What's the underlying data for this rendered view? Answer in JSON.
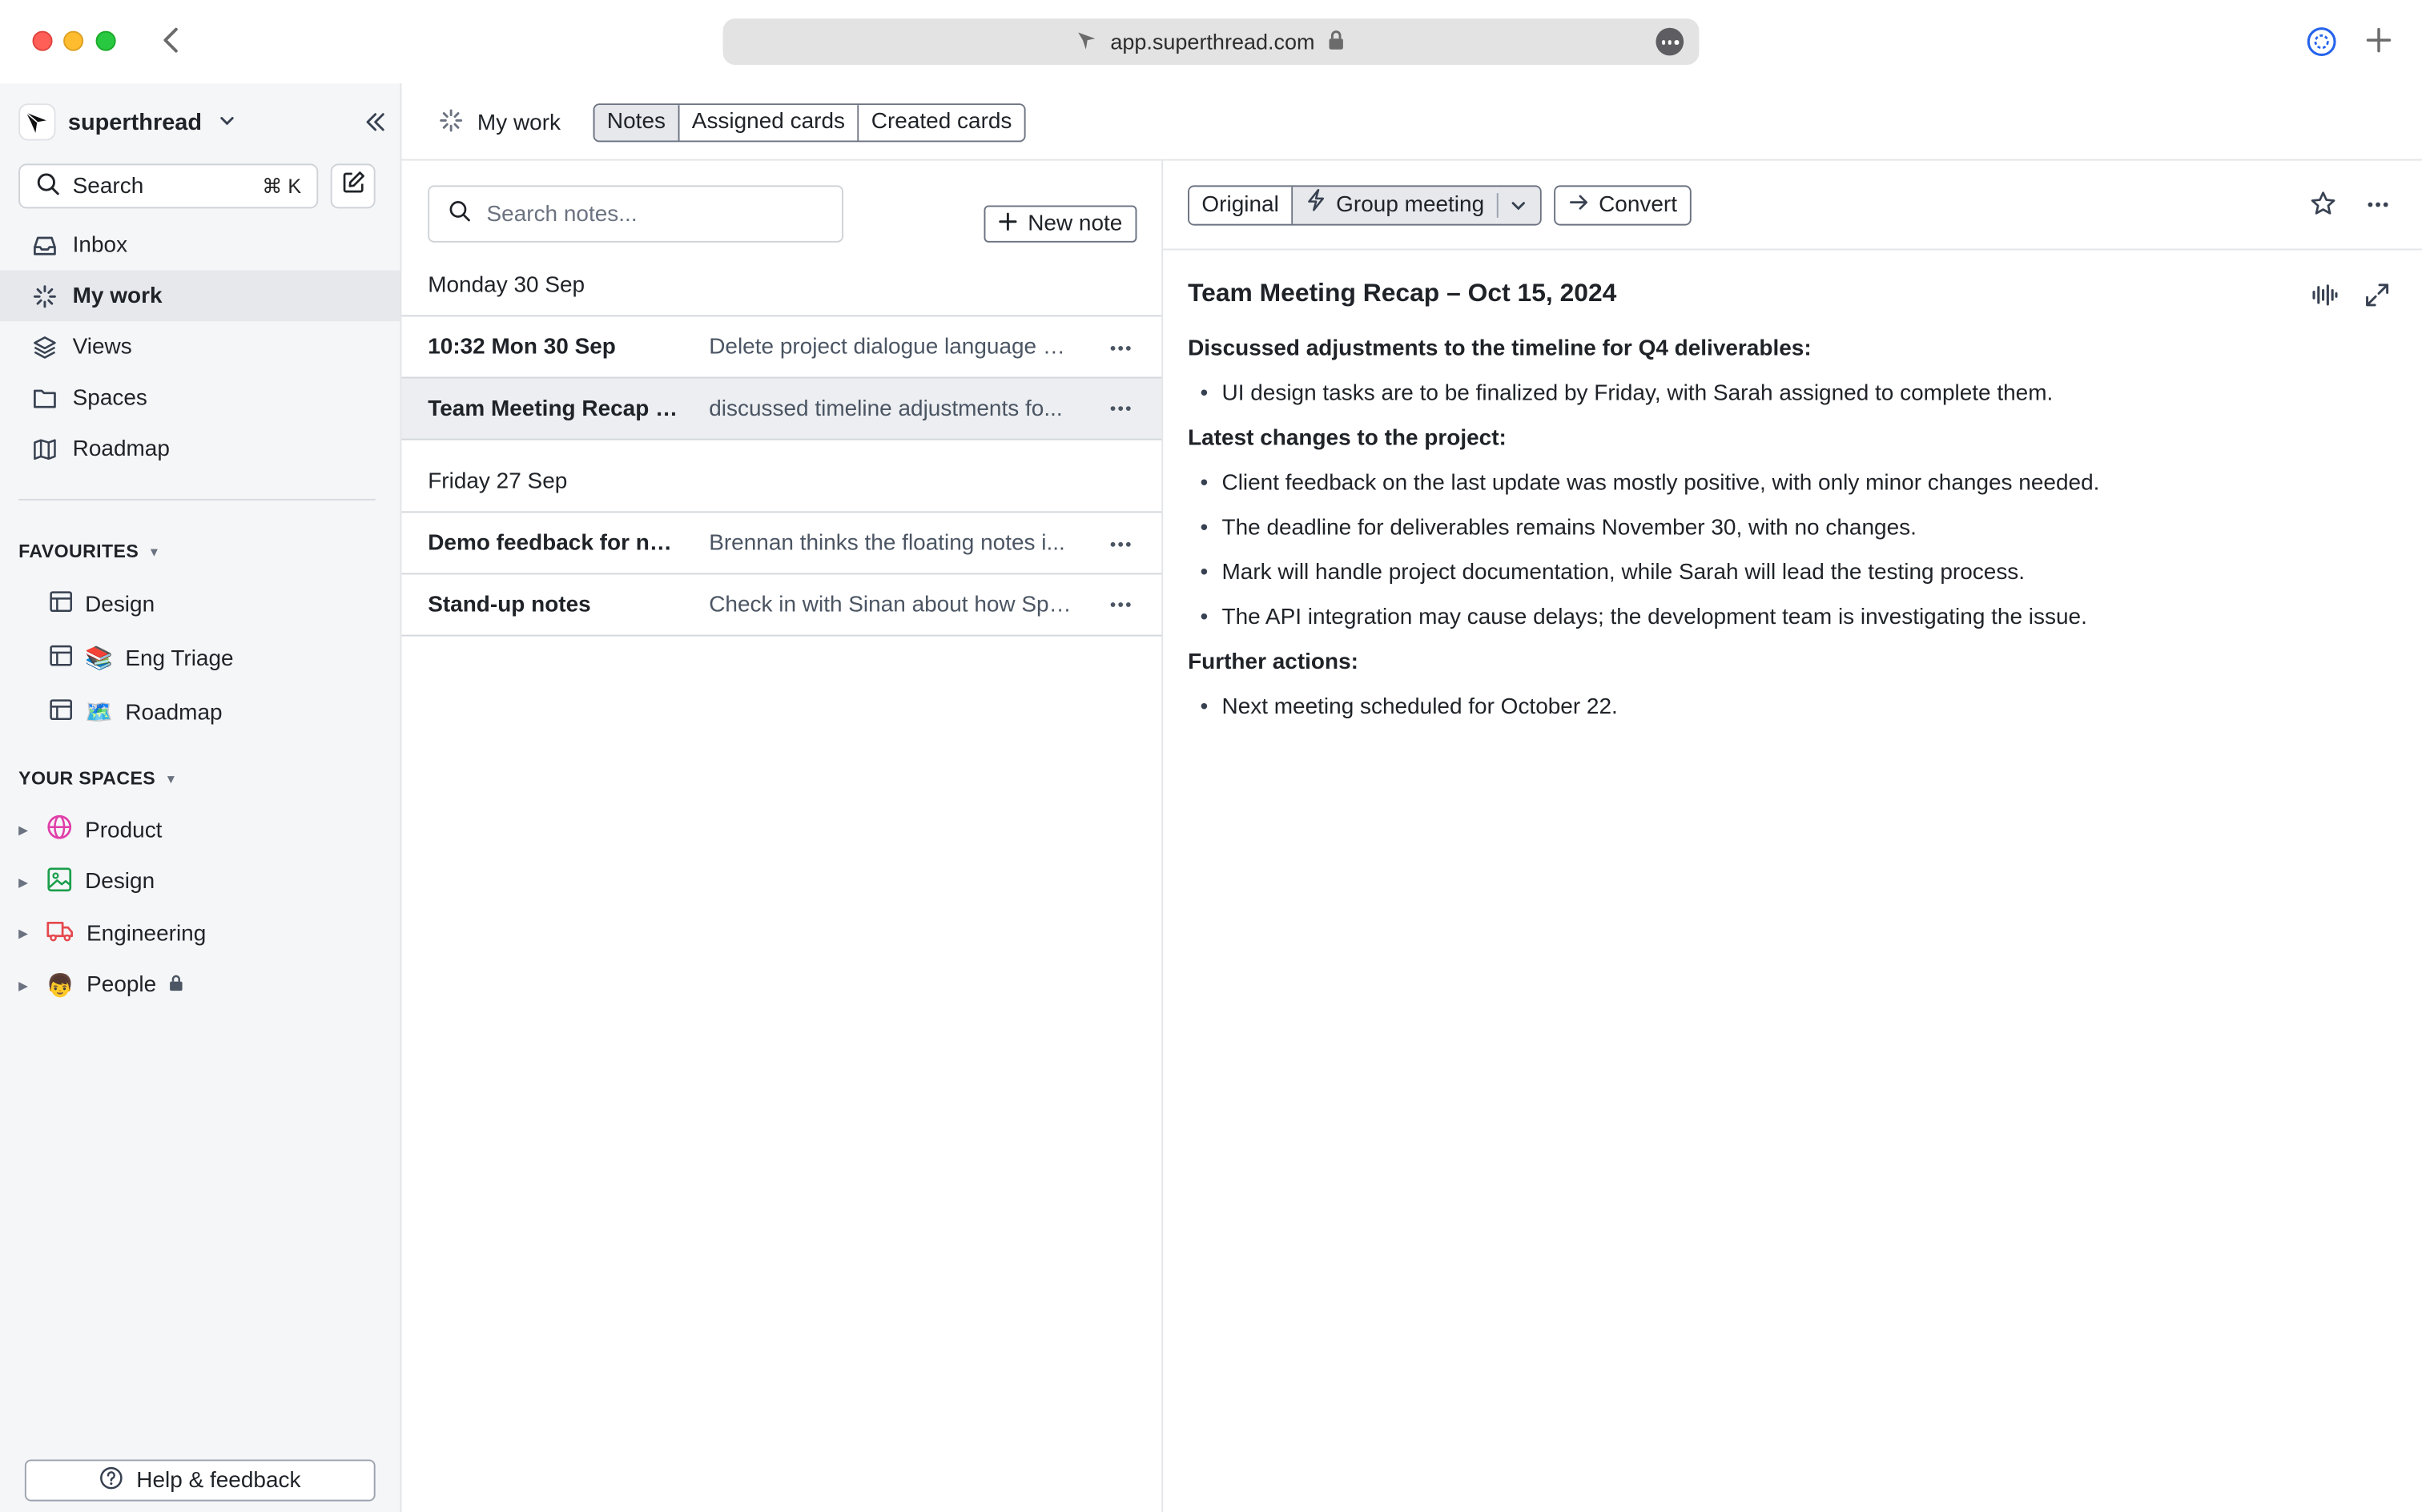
{
  "browser": {
    "url": "app.superthread.com"
  },
  "sidebar": {
    "workspace_name": "superthread",
    "search_label": "Search",
    "search_shortcut": "⌘ K",
    "nav": [
      {
        "label": "Inbox",
        "icon": "inbox-icon"
      },
      {
        "label": "My work",
        "icon": "mywork-icon",
        "active": true
      },
      {
        "label": "Views",
        "icon": "layers-icon"
      },
      {
        "label": "Spaces",
        "icon": "folder-icon"
      },
      {
        "label": "Roadmap",
        "icon": "map-icon"
      }
    ],
    "favourites_header": "FAVOURITES",
    "favourites": [
      {
        "label": "Design",
        "emoji": ""
      },
      {
        "label": "Eng Triage",
        "emoji": "📚"
      },
      {
        "label": "Roadmap",
        "emoji": "🗺️"
      }
    ],
    "spaces_header": "YOUR SPACES",
    "spaces": [
      {
        "label": "Product",
        "icon": "globe-icon",
        "color": "#e03ea8"
      },
      {
        "label": "Design",
        "icon": "image-icon",
        "color": "#1a9e4b"
      },
      {
        "label": "Engineering",
        "icon": "truck-icon",
        "color": "#e5484d"
      },
      {
        "label": "People",
        "icon": "person-emoji-icon",
        "emoji": "👦",
        "locked": true
      }
    ],
    "help_label": "Help & feedback"
  },
  "topbar": {
    "title": "My work",
    "tabs": [
      {
        "label": "Notes",
        "active": true
      },
      {
        "label": "Assigned cards",
        "active": false
      },
      {
        "label": "Created cards",
        "active": false
      }
    ]
  },
  "notes": {
    "search_placeholder": "Search notes...",
    "new_note_label": "New note",
    "groups": [
      {
        "date": "Monday 30 Sep",
        "items": [
          {
            "title": "10:32 Mon 30 Sep",
            "snippet": "Delete project dialogue language d..."
          },
          {
            "title": "Team Meeting Recap –...",
            "snippet": "discussed timeline adjustments fo...",
            "selected": true
          }
        ]
      },
      {
        "date": "Friday 27 Sep",
        "items": [
          {
            "title": "Demo feedback for notes",
            "snippet": "Brennan thinks the floating notes i..."
          },
          {
            "title": "Stand-up notes",
            "snippet": "Check in with Sinan about how Spri..."
          }
        ]
      }
    ]
  },
  "detail": {
    "template_original": "Original",
    "template_selected": "Group meeting",
    "convert_label": "Convert",
    "title": "Team Meeting Recap – Oct 15, 2024",
    "sections": [
      {
        "heading": "Discussed adjustments to the timeline for Q4 deliverables:",
        "bullets": [
          "UI design tasks are to be finalized by Friday, with Sarah assigned to complete them."
        ]
      },
      {
        "heading": "Latest changes to the project:",
        "bullets": [
          "Client feedback on the last update was mostly positive, with only minor changes needed.",
          "The deadline for deliverables remains November 30, with no changes.",
          "Mark will handle project documentation, while Sarah will lead the testing process.",
          "The API integration may cause delays; the development team is investigating the issue."
        ]
      },
      {
        "heading": "Further actions:",
        "bullets": [
          "Next meeting scheduled for October 22."
        ]
      }
    ]
  }
}
